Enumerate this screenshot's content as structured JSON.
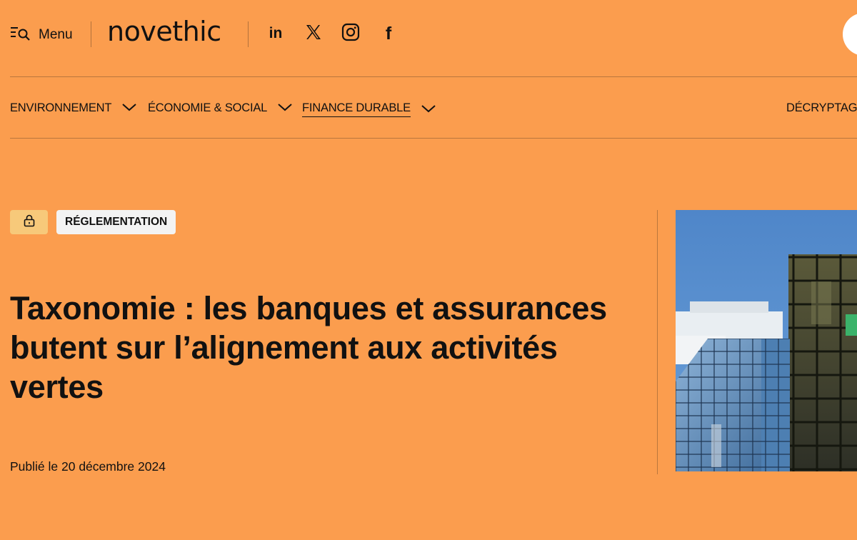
{
  "header": {
    "menu_label": "Menu",
    "logo": "novethic",
    "social": [
      {
        "icon": "linkedin-icon",
        "label": "in"
      },
      {
        "icon": "x-icon"
      },
      {
        "icon": "instagram-icon"
      },
      {
        "icon": "facebook-icon",
        "label": "f"
      }
    ]
  },
  "nav": {
    "items": [
      {
        "label": "ENVIRONNEMENT",
        "has_dropdown": true
      },
      {
        "label": "ÉCONOMIE & SOCIAL",
        "has_dropdown": true
      },
      {
        "label": "FINANCE DURABLE",
        "has_dropdown": true,
        "active": true
      },
      {
        "label": "DÉCRYPTAGE",
        "has_dropdown": false
      }
    ]
  },
  "article": {
    "locked": true,
    "category": "RÉGLEMENTATION",
    "title": "Taxonomie : les banques et assurances butent sur l’alignement aux activités vertes",
    "published": "Publié le 20 décembre 2024",
    "hero_image": "glass-office-buildings"
  },
  "colors": {
    "background": "#fb9d4e",
    "lock_badge": "#f7c97a",
    "category_badge": "#f3f3f3",
    "text": "#111111"
  }
}
